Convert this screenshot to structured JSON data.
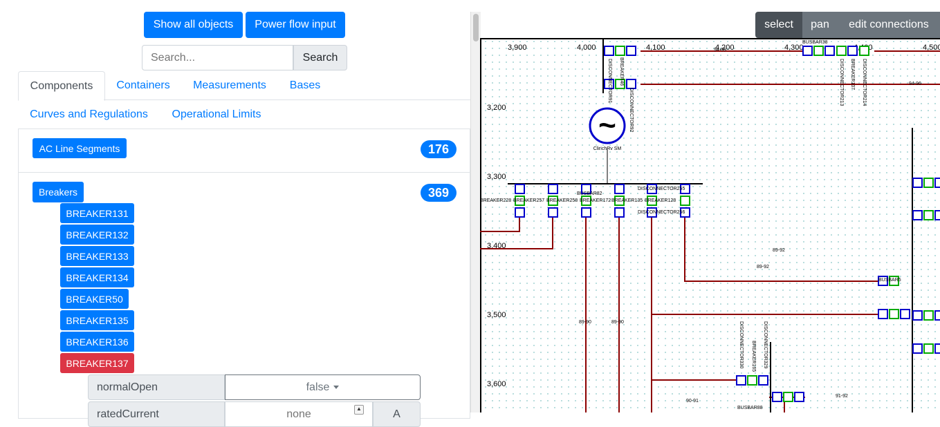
{
  "toolbar": {
    "show_all": "Show all objects",
    "power_flow": "Power flow input"
  },
  "search": {
    "placeholder": "Search...",
    "button": "Search"
  },
  "tabs": [
    {
      "label": "Components",
      "active": true
    },
    {
      "label": "Containers"
    },
    {
      "label": "Measurements"
    },
    {
      "label": "Bases"
    },
    {
      "label": "Curves and Regulations"
    },
    {
      "label": "Operational Limits"
    }
  ],
  "categories": {
    "ac_line_segments": {
      "label": "AC Line Segments",
      "count": "176"
    },
    "breakers": {
      "label": "Breakers",
      "count": "369"
    }
  },
  "breakers": [
    "BREAKER131",
    "BREAKER132",
    "BREAKER133",
    "BREAKER134",
    "BREAKER50",
    "BREAKER135",
    "BREAKER136",
    "BREAKER137"
  ],
  "selected_breaker": "BREAKER137",
  "attributes": {
    "normal_open": {
      "label": "normalOpen",
      "value": "false"
    },
    "rated_current": {
      "label": "ratedCurrent",
      "placeholder": "none",
      "unit": "A"
    }
  },
  "modes": {
    "select": "select",
    "pan": "pan",
    "edit": "edit connections"
  },
  "colors": {
    "accent": "#007bff",
    "danger": "#dc3545",
    "mode_active": "#495057",
    "mode": "#6c757d",
    "line": "#8b0000",
    "breaker": "#0000cc",
    "bus": "#00aa00"
  },
  "diagram": {
    "x_ticks": [
      "3,900",
      "4,000",
      "4,100",
      "4,200",
      "4,300",
      "4,400",
      "4,500"
    ],
    "y_ticks": [
      "3,200",
      "3,300",
      "3,400",
      "3,500",
      "3,600"
    ],
    "generator_label": "ClirichRv SM",
    "labels": {
      "busbar38": "BUSBAR38",
      "busbar82": "BUSBAR82",
      "busbar5": "BUSBAR5",
      "busbar88": "BUSBAR88",
      "disc91": "DISCONNECTOR91",
      "disc92": "DISCONNECTOR92",
      "breaker46": "BREAKER46",
      "disc213": "DISCONNECTOR213",
      "breaker107": "BREAKER107",
      "disc214": "DISCONNECTOR214",
      "disc255": "DISCONNECTOR255",
      "disc256": "DISCONNECTOR256",
      "breaker228": "BREAKER228",
      "breaker257": "BREAKER257",
      "breaker258": "BREAKER258",
      "breaker172": "BREAKER172",
      "breaker135d": "BREAKER135",
      "breaker128": "BREAKER128",
      "disc330": "DISCONNECTOR330",
      "disc329": "DISCONNECTOR329",
      "breaker165": "BREAKER165",
      "r89_92a": "89-92",
      "r89_92b": "89-92",
      "r89_90a": "89-90",
      "r89_90b": "89-90",
      "r90_91": "90-91",
      "r91_92": "91-92",
      "r94_96": "94-96",
      "r94_95": "94-95"
    }
  }
}
